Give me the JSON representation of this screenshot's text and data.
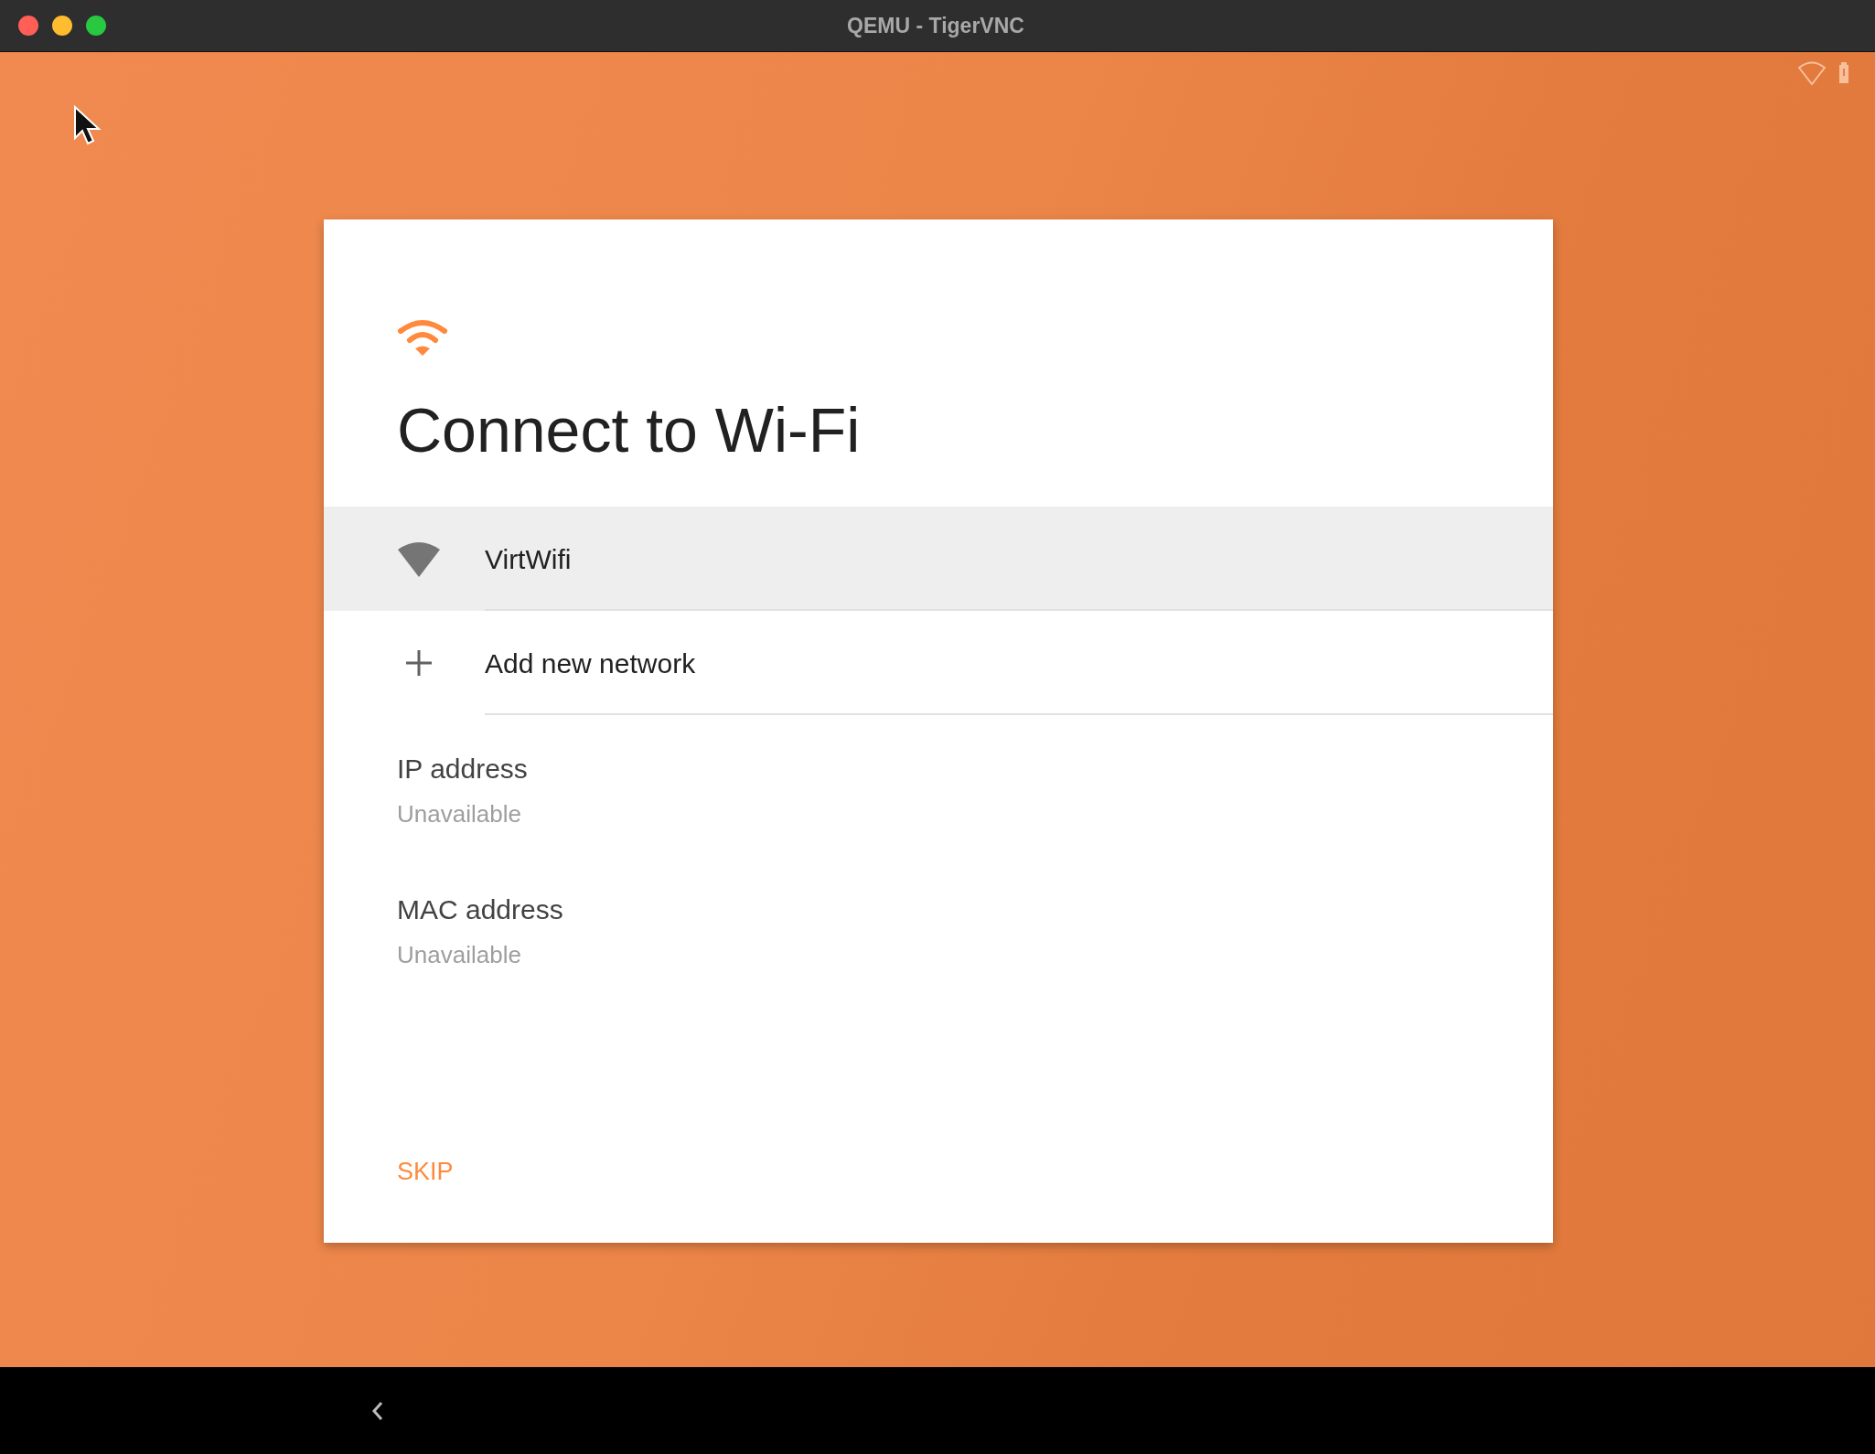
{
  "window": {
    "title": "QEMU - TigerVNC"
  },
  "card": {
    "title": "Connect to Wi-Fi",
    "networks": [
      {
        "kind": "wifi",
        "name": "VirtWifi",
        "selected": true
      },
      {
        "kind": "add",
        "name": "Add new network",
        "selected": false
      }
    ],
    "details": [
      {
        "label": "IP address",
        "value": "Unavailable"
      },
      {
        "label": "MAC address",
        "value": "Unavailable"
      }
    ],
    "skip_button": "SKIP"
  }
}
